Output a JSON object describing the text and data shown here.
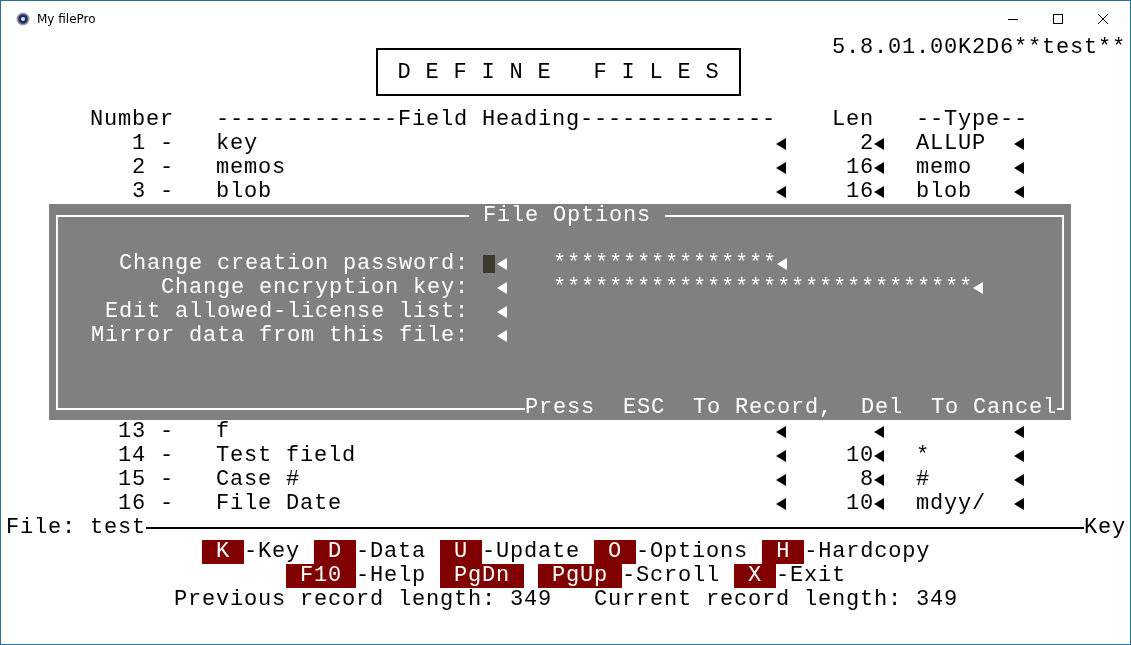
{
  "window": {
    "title": "My filePro"
  },
  "version": "5.8.01.00K2D6**test**",
  "screen_title": "D E F I N E   F I L E S",
  "columns": [
    "Number",
    "-------------Field Heading--------------",
    "Len",
    "--Type--"
  ],
  "fields": [
    {
      "number": "1 -",
      "heading": "key",
      "len": "2",
      "type": "ALLUP"
    },
    {
      "number": "2 -",
      "heading": "memos",
      "len": "16",
      "type": "memo"
    },
    {
      "number": "3 -",
      "heading": "blob",
      "len": "16",
      "type": "blob"
    },
    {
      "number": "13 -",
      "heading": "f"
    },
    {
      "number": "14 -",
      "heading": "Test field",
      "len": "10",
      "type": "*"
    },
    {
      "number": "15 -",
      "heading": "Case #",
      "len": "8",
      "type": "#"
    },
    {
      "number": "16 -",
      "heading": "File Date",
      "len": "10",
      "type": "mdyy/"
    }
  ],
  "dialog": {
    "title": "File Options",
    "options": [
      {
        "label": "Change creation password:",
        "value": "****************",
        "focused": true
      },
      {
        "label": "Change encryption key:",
        "value": "******************************",
        "focused": false
      },
      {
        "label": "Edit allowed-license list:",
        "focused": false
      },
      {
        "label": "Mirror data from this file:",
        "focused": false
      }
    ],
    "footer": "Press  ESC  To Record,  Del  To Cancel"
  },
  "status": {
    "file": "File: test",
    "key": "Key"
  },
  "command_rows": [
    [
      {
        "key": "K",
        "label": "-Key"
      },
      {
        "key": "D",
        "label": "-Data"
      },
      {
        "key": "U",
        "label": "-Update"
      },
      {
        "key": "O",
        "label": "-Options"
      },
      {
        "key": "H",
        "label": "-Hardcopy"
      }
    ],
    [
      {
        "key": "F10",
        "label": "-Help"
      },
      {
        "key": "PgDn"
      },
      {
        "key": "PgUp",
        "label": "-Scroll"
      },
      {
        "key": "X",
        "label": "-Exit"
      }
    ]
  ],
  "record_lengths": [
    "Previous record length: 349",
    "Current record length: 349"
  ]
}
